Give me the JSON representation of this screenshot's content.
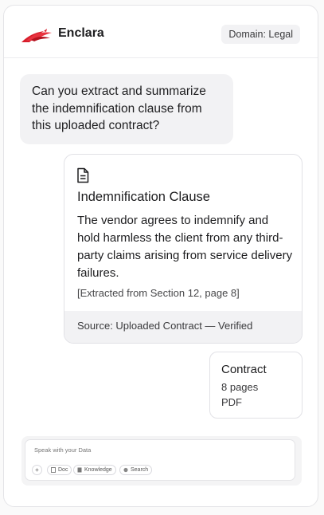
{
  "header": {
    "brand": "Enclara",
    "domain_badge": "Domain: Legal"
  },
  "conversation": {
    "user_message": "Can you extract and summarize the indemnification clause from this uploaded contract?",
    "clause_card": {
      "icon": "document-icon",
      "title": "Indemnification Clause",
      "body": "The vendor agrees to indemnify and hold harmless the client from any third-party claims arising from service delivery failures.",
      "reference": "[Extracted from Section 12, page 8]",
      "source": "Source: Uploaded Contract — Verified"
    },
    "attachment": {
      "name": "Contract",
      "pages": "8 pages",
      "type": "PDF"
    }
  },
  "composer": {
    "placeholder": "Speak with your Data",
    "chips": {
      "add": "+",
      "doc": "Doc",
      "knowledge": "Knowledge",
      "search": "Search"
    }
  },
  "colors": {
    "brand_red": "#d81e2c",
    "bubble_bg": "#f2f2f4",
    "border": "#e1e1e6"
  }
}
